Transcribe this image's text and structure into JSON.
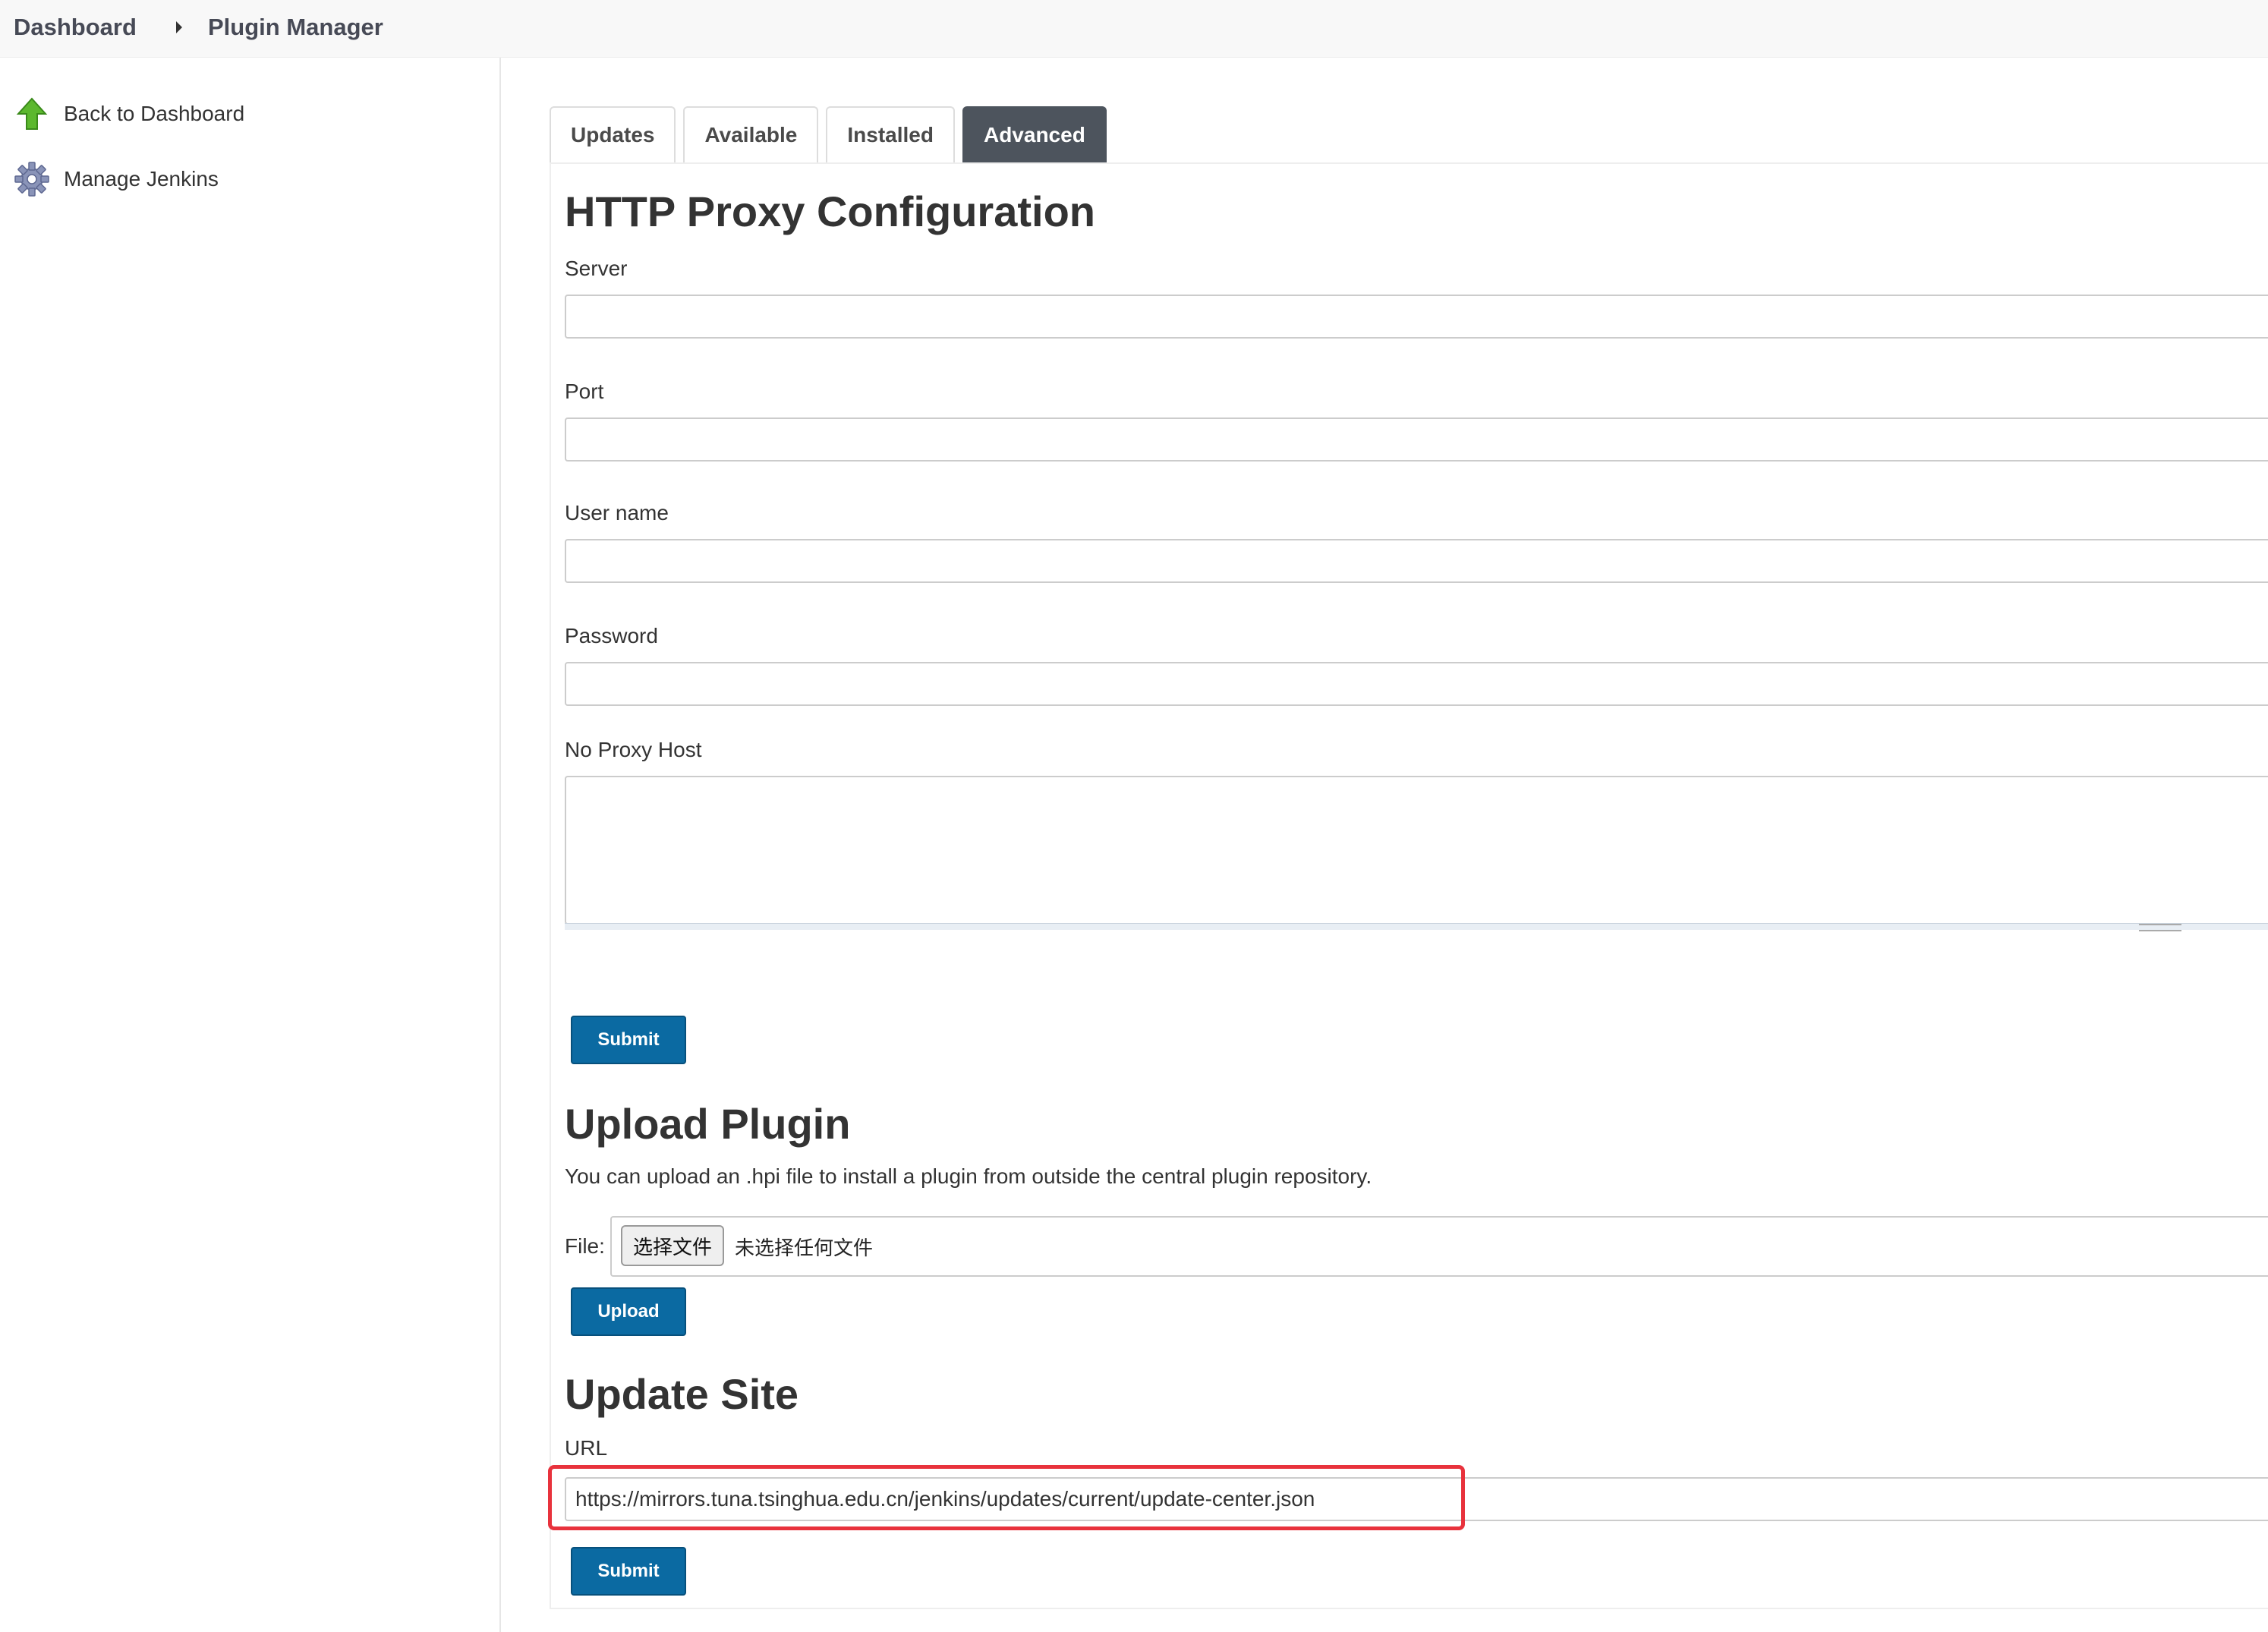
{
  "breadcrumb": {
    "items": [
      "Dashboard",
      "Plugin Manager"
    ]
  },
  "sidebar": {
    "items": [
      {
        "label": "Back to Dashboard",
        "icon": "up-arrow-icon"
      },
      {
        "label": "Manage Jenkins",
        "icon": "gear-icon"
      }
    ]
  },
  "tabs": [
    {
      "label": "Updates",
      "active": false
    },
    {
      "label": "Available",
      "active": false
    },
    {
      "label": "Installed",
      "active": false
    },
    {
      "label": "Advanced",
      "active": true
    }
  ],
  "proxy": {
    "title": "HTTP Proxy Configuration",
    "server_label": "Server",
    "server_value": "",
    "port_label": "Port",
    "port_value": "",
    "username_label": "User name",
    "username_value": "",
    "password_label": "Password",
    "password_value": "",
    "noproxy_label": "No Proxy Host",
    "noproxy_value": "",
    "submit_label": "Submit"
  },
  "upload": {
    "title": "Upload Plugin",
    "description": "You can upload an .hpi file to install a plugin from outside the central plugin repository.",
    "file_label": "File:",
    "choose_label": "选择文件",
    "file_status": "未选择任何文件",
    "upload_label": "Upload"
  },
  "update_site": {
    "title": "Update Site",
    "url_label": "URL",
    "url_value": "https://mirrors.tuna.tsinghua.edu.cn/jenkins/updates/current/update-center.json",
    "submit_label": "Submit"
  },
  "colors": {
    "primary_button": "#0b6aa2",
    "active_tab": "#4d545d",
    "highlight": "#e8323c"
  }
}
